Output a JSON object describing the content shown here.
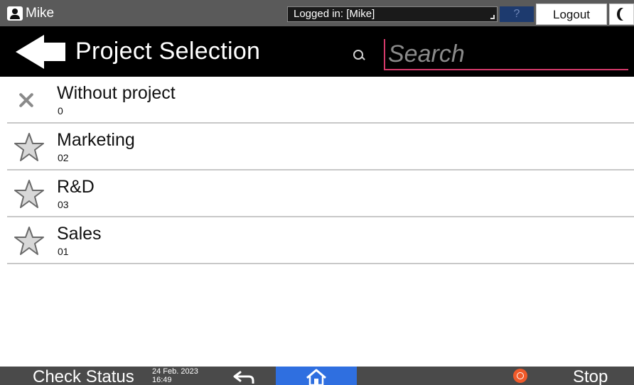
{
  "topbar": {
    "user_name": "Mike",
    "login_status": "Logged in: [Mike]",
    "help_label": "?",
    "logout_label": "Logout"
  },
  "header": {
    "title": "Project Selection",
    "search_placeholder": "Search",
    "search_value": ""
  },
  "projects": [
    {
      "name": "Without project",
      "code": "0",
      "icon": "close-icon"
    },
    {
      "name": "Marketing",
      "code": "02",
      "icon": "star-icon"
    },
    {
      "name": "R&D",
      "code": "03",
      "icon": "star-icon"
    },
    {
      "name": "Sales",
      "code": "01",
      "icon": "star-icon"
    }
  ],
  "bottombar": {
    "check_status_label": "Check Status",
    "date": "24 Feb. 2023",
    "time": "16:49",
    "stop_label": "Stop"
  },
  "colors": {
    "header_bg": "#000000",
    "accent_search": "#d63a6b",
    "home_button": "#2f6fe0",
    "stop_icon": "#f05a2a"
  }
}
